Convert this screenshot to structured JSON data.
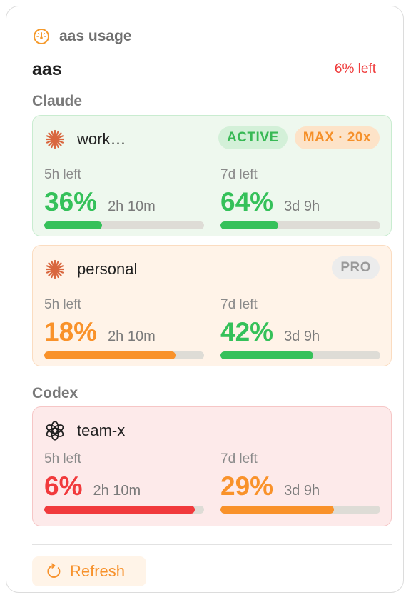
{
  "header": {
    "title": "aas usage",
    "icon": "gauge-icon"
  },
  "account": {
    "name": "aas",
    "remaining": "6% left"
  },
  "sections": [
    {
      "title": "Claude",
      "cards": [
        {
          "name": "work…",
          "icon": "claude-icon",
          "theme": "green",
          "badges": [
            {
              "label": "ACTIVE",
              "kind": "active"
            },
            {
              "label": "MAX · 20x",
              "kind": "max"
            }
          ],
          "limits": [
            {
              "label": "5h left",
              "percent": "36%",
              "reset": "2h 10m",
              "fraction": 0.36,
              "color": "green"
            },
            {
              "label": "7d left",
              "percent": "64%",
              "reset": "3d 9h",
              "fraction": 0.36,
              "color": "green"
            }
          ]
        },
        {
          "name": "personal",
          "icon": "claude-icon",
          "theme": "orange",
          "badges": [
            {
              "label": "PRO",
              "kind": "pro"
            }
          ],
          "limits": [
            {
              "label": "5h left",
              "percent": "18%",
              "reset": "2h 10m",
              "fraction": 0.82,
              "color": "orange"
            },
            {
              "label": "7d left",
              "percent": "42%",
              "reset": "3d 9h",
              "fraction": 0.58,
              "color": "green"
            }
          ]
        }
      ]
    },
    {
      "title": "Codex",
      "cards": [
        {
          "name": "team-x",
          "icon": "openai-icon",
          "theme": "red",
          "badges": [],
          "limits": [
            {
              "label": "5h left",
              "percent": "6%",
              "reset": "2h 10m",
              "fraction": 0.94,
              "color": "red"
            },
            {
              "label": "7d left",
              "percent": "29%",
              "reset": "3d 9h",
              "fraction": 0.71,
              "color": "orange"
            }
          ]
        }
      ]
    }
  ],
  "actions": {
    "refresh_label": "Refresh",
    "refresh_icon": "refresh-icon"
  },
  "colors": {
    "green": "#35c15a",
    "orange": "#f9922a",
    "red": "#f13a3c"
  }
}
